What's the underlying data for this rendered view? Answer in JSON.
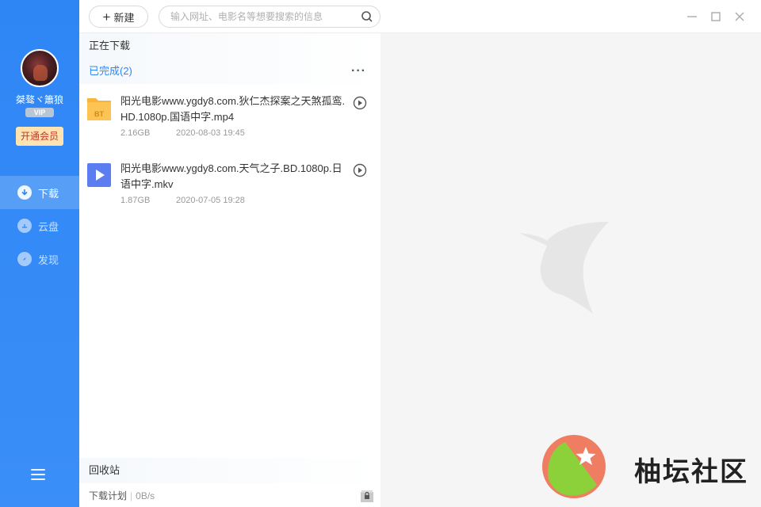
{
  "sidebar": {
    "username": "桀骜ヾ簫狼",
    "vip_label": "VIP",
    "member_button": "开通会员",
    "nav": [
      {
        "label": "下载",
        "icon": "download-icon",
        "active": true
      },
      {
        "label": "云盘",
        "icon": "cloud-icon",
        "active": false
      },
      {
        "label": "发现",
        "icon": "compass-icon",
        "active": false
      }
    ],
    "menu_icon": "menu-icon"
  },
  "toolbar": {
    "new_label": "新建",
    "search_placeholder": "输入网址、电影名等想要搜索的信息"
  },
  "sections": {
    "downloading": "正在下载",
    "completed": "已完成(2)",
    "recycle": "回收站"
  },
  "downloads": [
    {
      "name": "阳光电影www.ygdy8.com.狄仁杰探案之天煞孤鸾.HD.1080p.国语中字.mp4",
      "size": "2.16GB",
      "date": "2020-08-03 19:45",
      "icon": "bt-folder-icon"
    },
    {
      "name": "阳光电影www.ygdy8.com.天气之子.BD.1080p.日语中字.mkv",
      "size": "1.87GB",
      "date": "2020-07-05 19:28",
      "icon": "video-file-icon"
    }
  ],
  "footer": {
    "plan_label": "下载计划",
    "speed": "0B/s"
  },
  "watermark": {
    "text": "柚坛社区"
  },
  "colors": {
    "accent": "#2e86f5",
    "sidebar": "#3b8ef7",
    "member_bg": "#ffe3b0",
    "member_text": "#c0392b"
  }
}
